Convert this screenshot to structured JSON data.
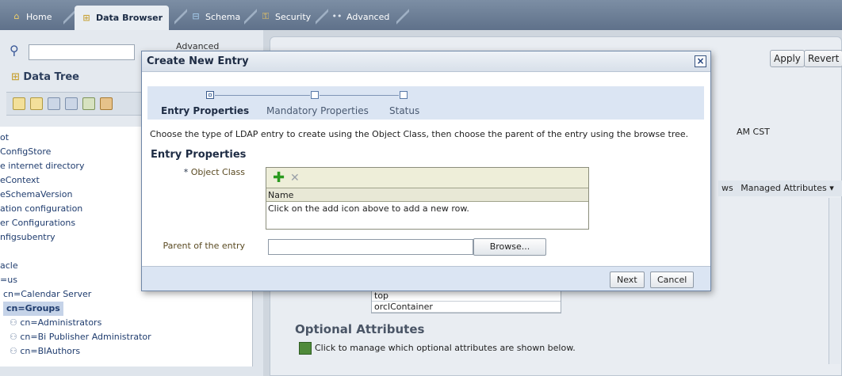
{
  "tabs": [
    {
      "label": "Home",
      "icon": "home-icon"
    },
    {
      "label": "Data Browser",
      "icon": "tree-icon"
    },
    {
      "label": "Schema",
      "icon": "schema-icon"
    },
    {
      "label": "Security",
      "icon": "security-icon"
    },
    {
      "label": "Advanced",
      "icon": "advanced-icon"
    }
  ],
  "left": {
    "advanced_label": "Advanced",
    "tree_title": "Data Tree",
    "items": [
      {
        "label": "ot"
      },
      {
        "label": "ConfigStore"
      },
      {
        "label": "e internet directory"
      },
      {
        "label": "eContext"
      },
      {
        "label": "eSchemaVersion"
      },
      {
        "label": "ation configuration"
      },
      {
        "label": "er Configurations"
      },
      {
        "label": "nfigsubentry"
      },
      {
        "label": "acle"
      },
      {
        "label": "=us"
      },
      {
        "label": "cn=Calendar Server"
      },
      {
        "label": "cn=Groups"
      },
      {
        "label": "cn=Administrators"
      },
      {
        "label": "cn=Bi Publisher Administrator"
      },
      {
        "label": "cn=BIAuthors"
      }
    ]
  },
  "right": {
    "apply_label": "Apply",
    "revert_label": "Revert",
    "time_text": "AM CST",
    "views_text": "ws",
    "managed_attrs_label": "Managed Attributes",
    "bg_rows": [
      "top",
      "orclContainer"
    ],
    "optional_title": "Optional Attributes",
    "optional_text": "Click to manage which optional attributes are shown below."
  },
  "modal": {
    "title": "Create New Entry",
    "close_label": "×",
    "train": [
      {
        "label": "Entry Properties",
        "current": true
      },
      {
        "label": "Mandatory Properties",
        "current": false
      },
      {
        "label": "Status",
        "current": false
      }
    ],
    "instructions": "Choose the type of LDAP entry to create using the Object Class, then choose the parent of the entry using the browse tree.",
    "section_title": "Entry Properties",
    "object_class_label": "Object Class",
    "required_mark": "*",
    "table_header": "Name",
    "table_empty_msg": "Click on the add icon above to add a new row.",
    "parent_label": "Parent of the entry",
    "parent_value": "",
    "browse_label": "Browse...",
    "next_label": "Next",
    "cancel_label": "Cancel"
  }
}
